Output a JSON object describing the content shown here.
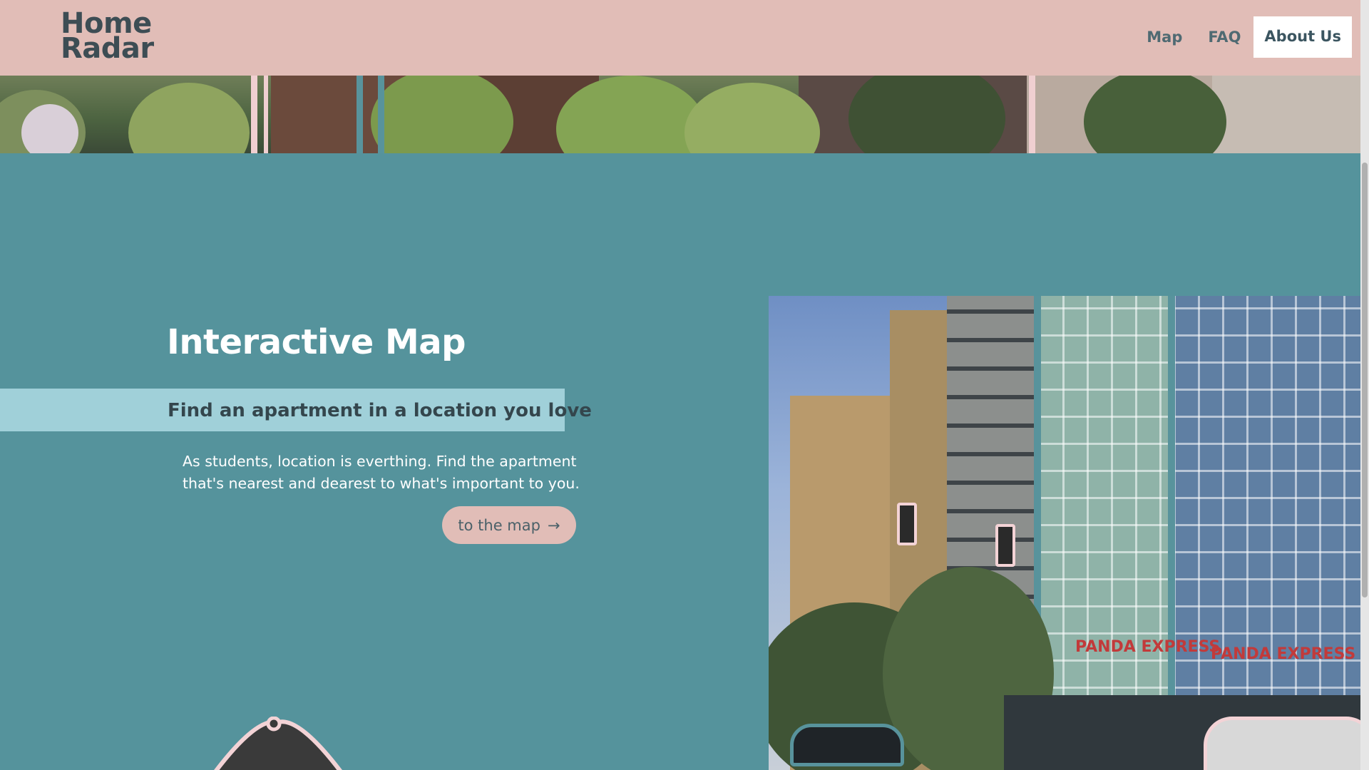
{
  "header": {
    "logo": {
      "line1": "Home",
      "line2": "Radar"
    },
    "nav": [
      {
        "label": "Map"
      },
      {
        "label": "FAQ"
      },
      {
        "label": "About Us",
        "active": true
      }
    ]
  },
  "hero": {
    "title": "Interactive Map",
    "subtitle": "Find an apartment in a location you love",
    "description": "As students, location is everthing. Find the apartment that's nearest and dearest to what's important to you.",
    "cta": {
      "label": "to the map",
      "icon": "arrow-right-icon",
      "glyph": "→"
    }
  },
  "images": {
    "top_strip": "street-trees-photo",
    "building": "apartment-building-photo",
    "storefront_signs": [
      "PANDA EXPRESS",
      "PANDA EXPRESS"
    ]
  },
  "colors": {
    "header_bg": "#e1bdb7",
    "page_bg": "#55939c",
    "band_bg": "#a0d0d9",
    "button_bg": "#e1bdb7",
    "nav_active_bg": "#ffffff",
    "text_dark": "#3d4d54"
  }
}
